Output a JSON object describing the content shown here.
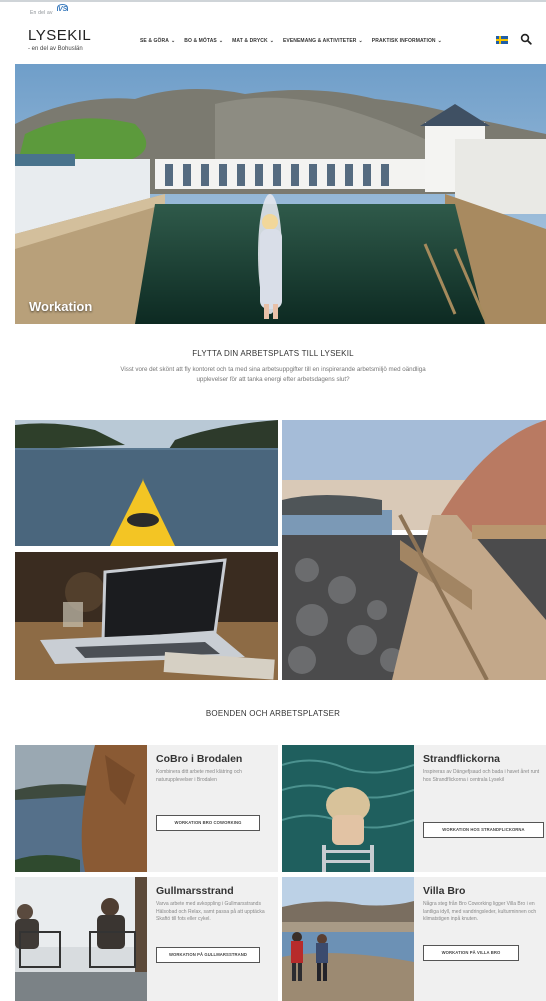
{
  "topbar": {
    "partner_text": "En del av",
    "partner_logo": "Vastsverige logo"
  },
  "header": {
    "site_title": "LYSEKIL",
    "site_subtitle": "- en del av Bohuslän"
  },
  "nav": {
    "items": [
      {
        "label": "SE & GÖRA"
      },
      {
        "label": "BO & MÖTAS"
      },
      {
        "label": "MAT & DRYCK"
      },
      {
        "label": "EVENEMANG & AKTIVITETER"
      },
      {
        "label": "PRAKTISK INFORMATION"
      }
    ],
    "language_flag": "swedish-flag",
    "search_icon": "search-icon"
  },
  "hero": {
    "label": "Workation"
  },
  "intro": {
    "title": "FLYTTA DIN ARBETSPLATS TILL LYSEKIL",
    "body": "Visst vore det skönt att fly kontoret och ta med sina arbetsuppgifter till en inspirerande arbetsmiljö med oändliga upplevelser för att tanka energi efter arbetsdagens slut?"
  },
  "section": {
    "title": "BOENDEN OCH ARBETSPLATSER"
  },
  "cards": [
    {
      "title": "CoBro i Brodalen",
      "description": "Kombinera ditt arbete med klätring och naturupplevelser i Brodalen",
      "button": "WORKATION BRO COWORKING"
    },
    {
      "title": "Strandflickorna",
      "description": "Inspireras av Dängefjsaud och bada i havet året runt hos Strandflickorna i centrala Lysekil",
      "button": "WORKATION HOS STRANDFLICKORNA"
    },
    {
      "title": "Gullmarsstrand",
      "description": "Varva arbete med avkoppling i Gullmarsstrands Hälsobad och Relax, samt passa på att upptäcka Skaftö till fots eller cykel.",
      "button": "WORKATION PÅ GULLMARSSTRAND"
    },
    {
      "title": "Villa Bro",
      "description": "Några steg från Bro Coworking ligger Villa Bro i en lantliga idyll, med vandringsleder, kulturminnen och klimatstigen inpå knuten.",
      "button": "WORKATION PÅ VILLA BRO"
    }
  ]
}
